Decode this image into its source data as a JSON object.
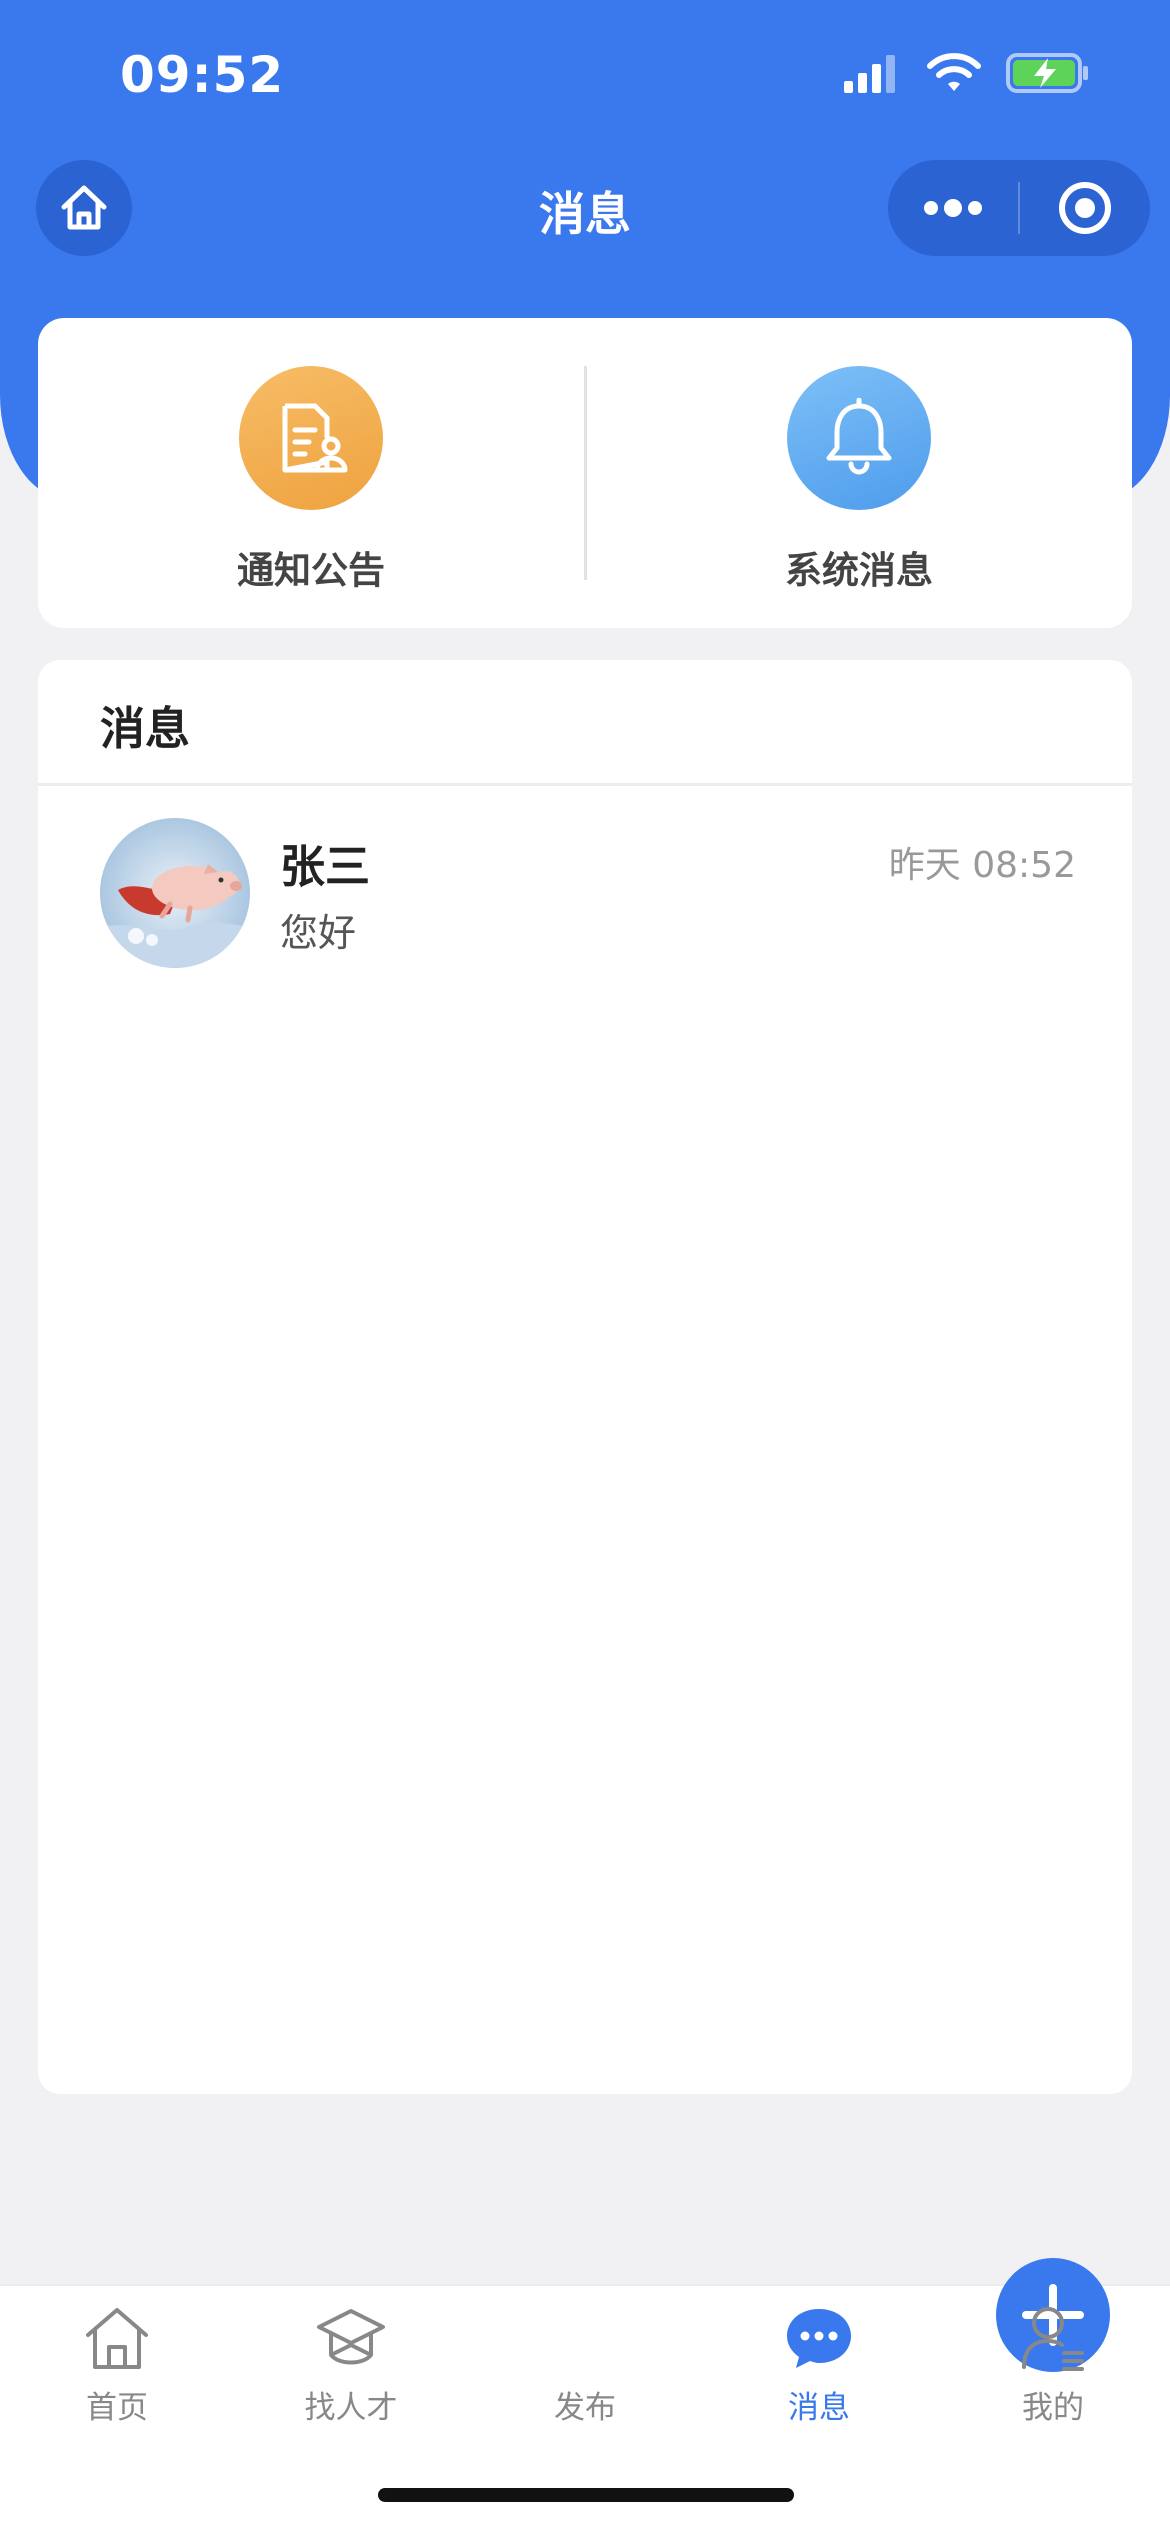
{
  "status_bar": {
    "time": "09:52",
    "icons": [
      "signal-icon",
      "wifi-icon",
      "battery-charging-icon"
    ]
  },
  "nav": {
    "title": "消息",
    "home_icon": "home-icon",
    "capsule_icons": [
      "more-icon",
      "target-icon"
    ]
  },
  "quick_entries": [
    {
      "label": "通知公告",
      "icon": "notice-document-icon",
      "color": "#f2a94e"
    },
    {
      "label": "系统消息",
      "icon": "bell-icon",
      "color": "#5ea8f0"
    }
  ],
  "messages_section": {
    "title": "消息",
    "items": [
      {
        "name": "张三",
        "preview": "您好",
        "time": "昨天 08:52",
        "avatar": "flying-pig-avatar"
      }
    ]
  },
  "tab_bar": {
    "items": [
      {
        "label": "首页",
        "icon": "home-outline-icon",
        "active": false
      },
      {
        "label": "找人才",
        "icon": "graduation-cap-icon",
        "active": false
      },
      {
        "label": "发布",
        "icon": "plus-icon",
        "active": false
      },
      {
        "label": "消息",
        "icon": "chat-bubble-icon",
        "active": true
      },
      {
        "label": "我的",
        "icon": "user-profile-icon",
        "active": false
      }
    ],
    "active_color": "#3a78ee"
  },
  "colors": {
    "primary": "#3a78ee",
    "background": "#f1f1f3"
  }
}
